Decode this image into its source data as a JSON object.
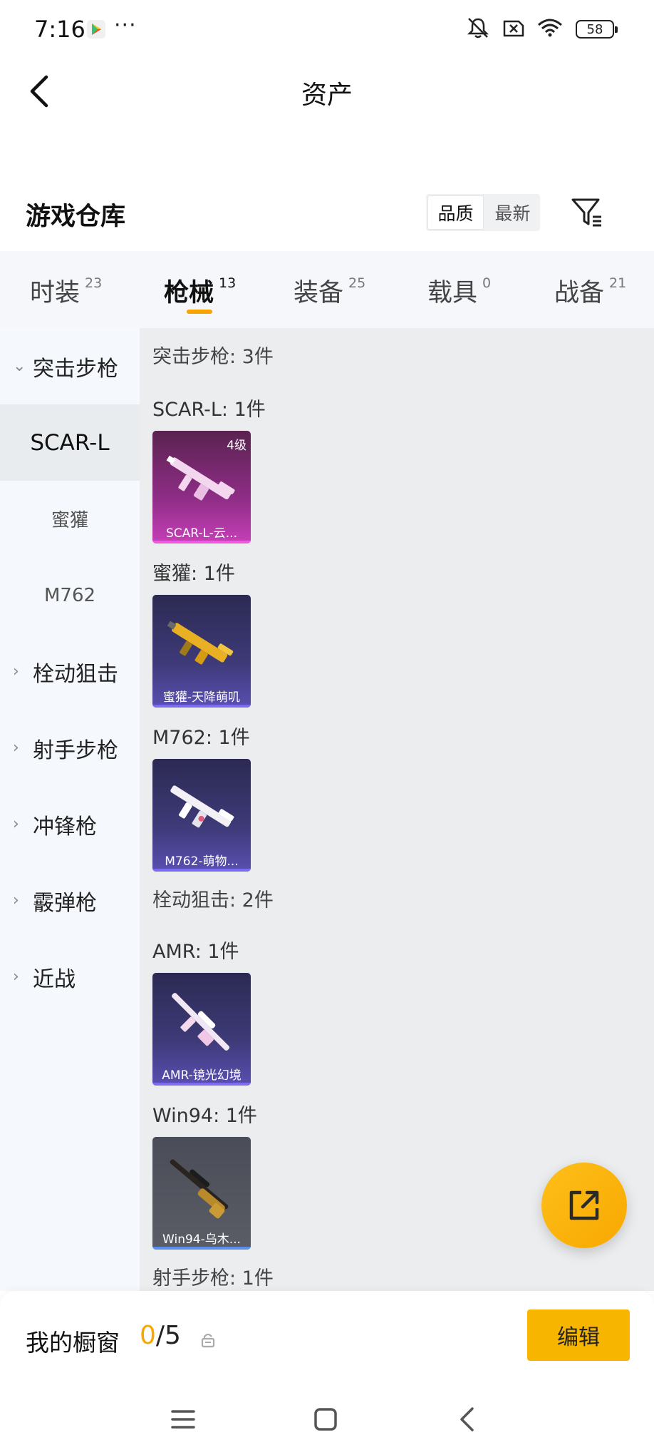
{
  "status": {
    "time": "7:16",
    "dots": "···",
    "battery": "58",
    "icons": [
      "play-store-icon",
      "mute-icon",
      "no-sim-icon",
      "wifi-icon",
      "battery-icon"
    ]
  },
  "header": {
    "title": "资产",
    "back_icon": "chevron-left-icon"
  },
  "warehouse": {
    "title": "游戏仓库",
    "sort_options": [
      "品质",
      "最新"
    ],
    "sort_selected": "品质",
    "filter_icon": "filter-icon"
  },
  "tabs": [
    {
      "label": "时装",
      "count": "23"
    },
    {
      "label": "枪械",
      "count": "13",
      "active": true
    },
    {
      "label": "装备",
      "count": "25"
    },
    {
      "label": "载具",
      "count": "0"
    },
    {
      "label": "战备",
      "count": "21"
    }
  ],
  "sidebar": {
    "groups": [
      {
        "label": "突击步枪",
        "expanded": true,
        "children": [
          "SCAR-L",
          "蜜獾",
          "M762"
        ],
        "selected": "SCAR-L"
      },
      {
        "label": "栓动狙击",
        "expanded": false
      },
      {
        "label": "射手步枪",
        "expanded": false
      },
      {
        "label": "冲锋枪",
        "expanded": false
      },
      {
        "label": "霰弹枪",
        "expanded": false
      },
      {
        "label": "近战",
        "expanded": false
      }
    ]
  },
  "content": {
    "sections": [
      {
        "title": "突击步枪: 3件",
        "subsections": [
          {
            "title": "SCAR-L: 1件",
            "items": [
              {
                "name": "SCAR-L-云...",
                "level": "4级",
                "rarity": "pink"
              }
            ]
          },
          {
            "title": "蜜獾: 1件",
            "items": [
              {
                "name": "蜜獾-天降萌叽",
                "rarity": "purple"
              }
            ]
          },
          {
            "title": "M762: 1件",
            "items": [
              {
                "name": "M762-萌物...",
                "rarity": "purple"
              }
            ]
          }
        ]
      },
      {
        "title": "栓动狙击: 2件",
        "subsections": [
          {
            "title": "AMR: 1件",
            "items": [
              {
                "name": "AMR-镜光幻境",
                "rarity": "purple"
              }
            ]
          },
          {
            "title": "Win94: 1件",
            "items": [
              {
                "name": "Win94-乌木...",
                "rarity": "gray"
              }
            ]
          }
        ]
      },
      {
        "title": "射手步枪: 1件",
        "subsections": []
      }
    ]
  },
  "fab": {
    "icon": "share-external-icon"
  },
  "showcase": {
    "label": "我的橱窗",
    "current": "0",
    "separator": "/",
    "max": "5",
    "lock_icon": "lock-icon",
    "edit_label": "编辑"
  },
  "system_nav": [
    "menu-icon",
    "home-icon",
    "back-icon"
  ],
  "colors": {
    "accent": "#f7a800",
    "tab_bg": "#f5f7fa",
    "content_bg": "#ecedef"
  }
}
